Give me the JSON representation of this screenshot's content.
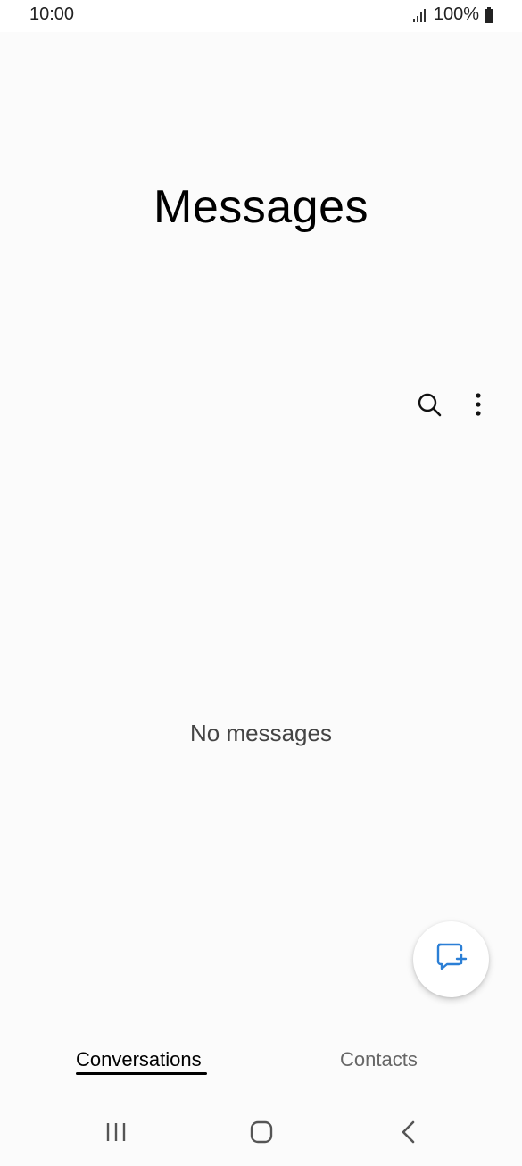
{
  "status_bar": {
    "time": "10:00",
    "battery": "100%",
    "icons": [
      "signal-icon",
      "battery-icon"
    ]
  },
  "header": {
    "title": "Messages"
  },
  "toolbar": {
    "icons": [
      "search-icon",
      "more-options-icon"
    ]
  },
  "main": {
    "empty_text": "No messages"
  },
  "fab": {
    "icon": "compose-message-icon",
    "accent_color": "#2b7fd6"
  },
  "tabs": [
    {
      "label": "Conversations",
      "selected": true
    },
    {
      "label": "Contacts",
      "selected": false
    }
  ],
  "nav_bar": {
    "icons": [
      "recent-apps-icon",
      "home-icon",
      "back-icon"
    ]
  }
}
